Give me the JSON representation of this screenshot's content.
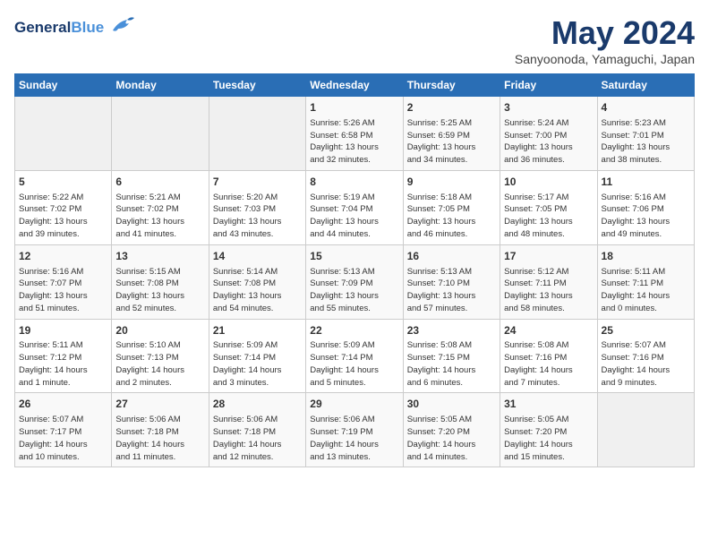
{
  "header": {
    "logo_general": "General",
    "logo_blue": "Blue",
    "month_title": "May 2024",
    "subtitle": "Sanyoonoda, Yamaguchi, Japan"
  },
  "days_of_week": [
    "Sunday",
    "Monday",
    "Tuesday",
    "Wednesday",
    "Thursday",
    "Friday",
    "Saturday"
  ],
  "weeks": [
    {
      "days": [
        {
          "num": "",
          "info": ""
        },
        {
          "num": "",
          "info": ""
        },
        {
          "num": "",
          "info": ""
        },
        {
          "num": "1",
          "info": "Sunrise: 5:26 AM\nSunset: 6:58 PM\nDaylight: 13 hours\nand 32 minutes."
        },
        {
          "num": "2",
          "info": "Sunrise: 5:25 AM\nSunset: 6:59 PM\nDaylight: 13 hours\nand 34 minutes."
        },
        {
          "num": "3",
          "info": "Sunrise: 5:24 AM\nSunset: 7:00 PM\nDaylight: 13 hours\nand 36 minutes."
        },
        {
          "num": "4",
          "info": "Sunrise: 5:23 AM\nSunset: 7:01 PM\nDaylight: 13 hours\nand 38 minutes."
        }
      ]
    },
    {
      "days": [
        {
          "num": "5",
          "info": "Sunrise: 5:22 AM\nSunset: 7:02 PM\nDaylight: 13 hours\nand 39 minutes."
        },
        {
          "num": "6",
          "info": "Sunrise: 5:21 AM\nSunset: 7:02 PM\nDaylight: 13 hours\nand 41 minutes."
        },
        {
          "num": "7",
          "info": "Sunrise: 5:20 AM\nSunset: 7:03 PM\nDaylight: 13 hours\nand 43 minutes."
        },
        {
          "num": "8",
          "info": "Sunrise: 5:19 AM\nSunset: 7:04 PM\nDaylight: 13 hours\nand 44 minutes."
        },
        {
          "num": "9",
          "info": "Sunrise: 5:18 AM\nSunset: 7:05 PM\nDaylight: 13 hours\nand 46 minutes."
        },
        {
          "num": "10",
          "info": "Sunrise: 5:17 AM\nSunset: 7:05 PM\nDaylight: 13 hours\nand 48 minutes."
        },
        {
          "num": "11",
          "info": "Sunrise: 5:16 AM\nSunset: 7:06 PM\nDaylight: 13 hours\nand 49 minutes."
        }
      ]
    },
    {
      "days": [
        {
          "num": "12",
          "info": "Sunrise: 5:16 AM\nSunset: 7:07 PM\nDaylight: 13 hours\nand 51 minutes."
        },
        {
          "num": "13",
          "info": "Sunrise: 5:15 AM\nSunset: 7:08 PM\nDaylight: 13 hours\nand 52 minutes."
        },
        {
          "num": "14",
          "info": "Sunrise: 5:14 AM\nSunset: 7:08 PM\nDaylight: 13 hours\nand 54 minutes."
        },
        {
          "num": "15",
          "info": "Sunrise: 5:13 AM\nSunset: 7:09 PM\nDaylight: 13 hours\nand 55 minutes."
        },
        {
          "num": "16",
          "info": "Sunrise: 5:13 AM\nSunset: 7:10 PM\nDaylight: 13 hours\nand 57 minutes."
        },
        {
          "num": "17",
          "info": "Sunrise: 5:12 AM\nSunset: 7:11 PM\nDaylight: 13 hours\nand 58 minutes."
        },
        {
          "num": "18",
          "info": "Sunrise: 5:11 AM\nSunset: 7:11 PM\nDaylight: 14 hours\nand 0 minutes."
        }
      ]
    },
    {
      "days": [
        {
          "num": "19",
          "info": "Sunrise: 5:11 AM\nSunset: 7:12 PM\nDaylight: 14 hours\nand 1 minute."
        },
        {
          "num": "20",
          "info": "Sunrise: 5:10 AM\nSunset: 7:13 PM\nDaylight: 14 hours\nand 2 minutes."
        },
        {
          "num": "21",
          "info": "Sunrise: 5:09 AM\nSunset: 7:14 PM\nDaylight: 14 hours\nand 3 minutes."
        },
        {
          "num": "22",
          "info": "Sunrise: 5:09 AM\nSunset: 7:14 PM\nDaylight: 14 hours\nand 5 minutes."
        },
        {
          "num": "23",
          "info": "Sunrise: 5:08 AM\nSunset: 7:15 PM\nDaylight: 14 hours\nand 6 minutes."
        },
        {
          "num": "24",
          "info": "Sunrise: 5:08 AM\nSunset: 7:16 PM\nDaylight: 14 hours\nand 7 minutes."
        },
        {
          "num": "25",
          "info": "Sunrise: 5:07 AM\nSunset: 7:16 PM\nDaylight: 14 hours\nand 9 minutes."
        }
      ]
    },
    {
      "days": [
        {
          "num": "26",
          "info": "Sunrise: 5:07 AM\nSunset: 7:17 PM\nDaylight: 14 hours\nand 10 minutes."
        },
        {
          "num": "27",
          "info": "Sunrise: 5:06 AM\nSunset: 7:18 PM\nDaylight: 14 hours\nand 11 minutes."
        },
        {
          "num": "28",
          "info": "Sunrise: 5:06 AM\nSunset: 7:18 PM\nDaylight: 14 hours\nand 12 minutes."
        },
        {
          "num": "29",
          "info": "Sunrise: 5:06 AM\nSunset: 7:19 PM\nDaylight: 14 hours\nand 13 minutes."
        },
        {
          "num": "30",
          "info": "Sunrise: 5:05 AM\nSunset: 7:20 PM\nDaylight: 14 hours\nand 14 minutes."
        },
        {
          "num": "31",
          "info": "Sunrise: 5:05 AM\nSunset: 7:20 PM\nDaylight: 14 hours\nand 15 minutes."
        },
        {
          "num": "",
          "info": ""
        }
      ]
    }
  ]
}
